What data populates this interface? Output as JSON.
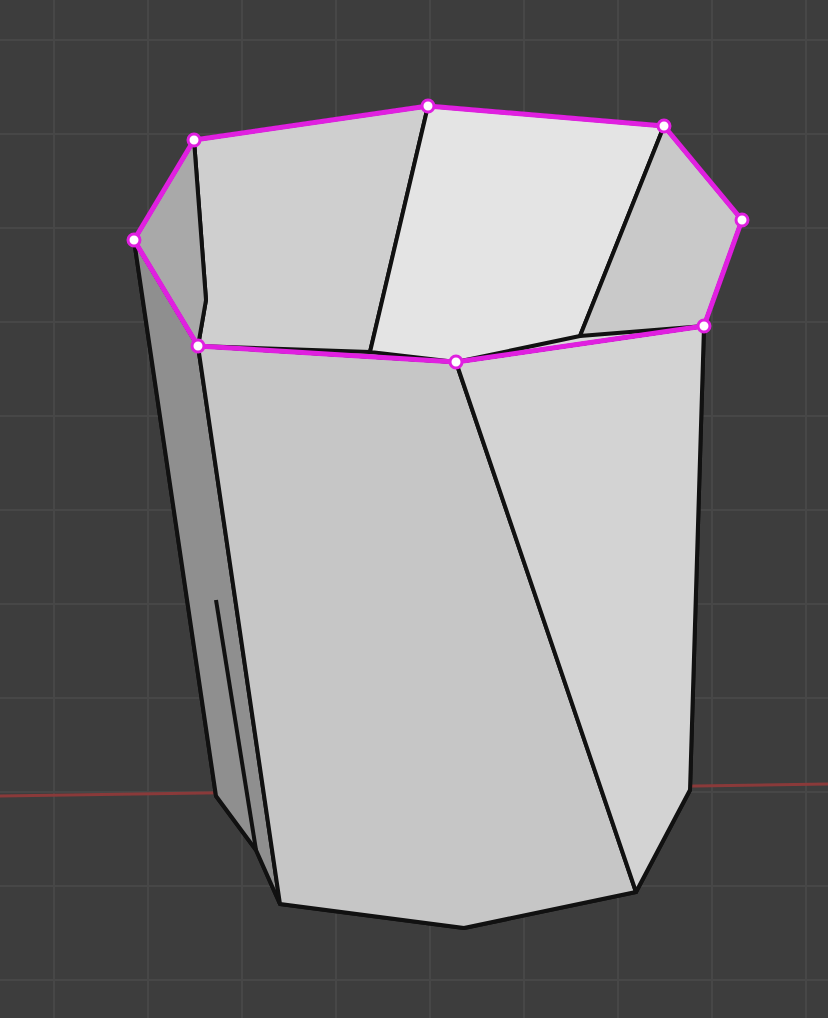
{
  "viewport": {
    "rim_loop_selected": true
  }
}
